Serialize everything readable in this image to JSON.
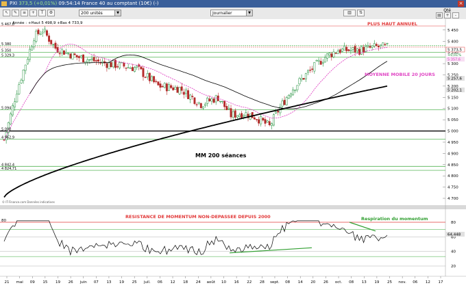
{
  "window": {
    "title_prefix": "PXI",
    "price": "373,5",
    "change": "(+0,01%)",
    "title_suffix": "09:54:14 France 40 au comptant (10€) (-)",
    "close_glyph": "×"
  },
  "toolbar": {
    "units_value": "200 unités",
    "period_value": "Journalier",
    "qty_label": "Qté",
    "dropdown_glyph": "▼"
  },
  "chart_data": {
    "type": "candlestick",
    "info_label": "Année : +Haut 5 498,9 +Bas 4 733,9",
    "source": "© IT-Finance.com Données indicatives",
    "ylim": [
      4690,
      5510
    ],
    "price_ticks": [
      "5 450",
      "5 400",
      "5 350",
      "5 300",
      "5 250",
      "5 200",
      "5 150",
      "5 100",
      "5 050",
      "5 000",
      "4 950",
      "4 900",
      "4 850",
      "4 800",
      "4 750",
      "4 700"
    ],
    "left_levels": [
      "5 467,8",
      "5 380",
      "5 350",
      "5 329,3",
      "5 094",
      "5 000",
      "4 962,9",
      "4 842,4",
      "4 824,71"
    ],
    "right_badges": [
      "5 373,5",
      "+0,01%",
      "5 357,6",
      "5 257,6",
      "5 202,1"
    ],
    "annotations": {
      "plus_haut": "PLUS HAUT ANNUEL",
      "moyenne_mobile": "MOYENNE MOBILE 20 JOURS",
      "mm200": "MM 200 séances",
      "resistance": "RESISTANCE DE MOMENTUM NON-DEPASSEE DEPUIS 2000",
      "respiration": "Respiration du momentum"
    },
    "osc_ylim": [
      0,
      100
    ],
    "osc_ticks": [
      "80",
      "60",
      "40",
      "20"
    ],
    "osc_top_label": "80",
    "osc_value": "64,448",
    "x_labels": [
      "21",
      "mai",
      "09",
      "15",
      "19",
      "26",
      "juin",
      "07",
      "13",
      "19",
      "25",
      "juil.",
      "06",
      "12",
      "18",
      "24",
      "août",
      "10",
      "16",
      "22",
      "28",
      "sept.",
      "08",
      "14",
      "20",
      "26",
      "oct.",
      "08",
      "13",
      "19",
      "25",
      "nov.",
      "06",
      "12",
      "17"
    ],
    "series": {
      "ohlc_count": 180,
      "sma20_color": "#e046c4",
      "sma50_color": "#000000",
      "sma200_color": "#000000"
    },
    "colors": {
      "up": "#1f8f3a",
      "down": "#b52a2a",
      "resistance_red": "#e23a3a",
      "support_green": "#35a835",
      "trend_green": "#2f9e2f"
    }
  }
}
